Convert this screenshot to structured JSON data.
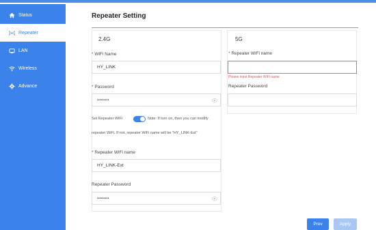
{
  "sidebar": {
    "items": [
      {
        "label": "Status",
        "icon": "home-icon",
        "active": false
      },
      {
        "label": "Repeater",
        "icon": "repeater-icon",
        "active": true
      },
      {
        "label": "LAN",
        "icon": "lan-icon",
        "active": false
      },
      {
        "label": "Wireless",
        "icon": "wifi-icon",
        "active": false
      },
      {
        "label": "Advance",
        "icon": "gear-icon",
        "active": false
      }
    ]
  },
  "page": {
    "title": "Repeater Setting"
  },
  "band24": {
    "heading": "2.4G",
    "wifi_name_label": "WiFi Name",
    "wifi_name_value": "HY_LINK",
    "password_label": "Password",
    "password_value": "•••••••••",
    "set_repeater_label": "Set Repeater WiFi",
    "note_line1": "Note: If turn on, then you can modify",
    "note_line2": "repeater WiFi. If not, repeater WiFi name will be \"HY_LINK-Ext\"",
    "repeater_name_label": "Repeater WiFi name",
    "repeater_name_value": "HY_LINK-Ext",
    "repeater_password_label": "Repeater Password",
    "repeater_password_value": "•••••••••"
  },
  "band5": {
    "heading": "5G",
    "repeater_name_label": "Repeater WiFi name",
    "repeater_name_value": "",
    "error_message": "Please input Repeater WiFi name",
    "repeater_password_label": "Repeater Password",
    "repeater_password_value": ""
  },
  "buttons": {
    "prev": "Prev",
    "apply": "Apply"
  },
  "colors": {
    "accent": "#3b83ea",
    "error": "#e55353"
  }
}
